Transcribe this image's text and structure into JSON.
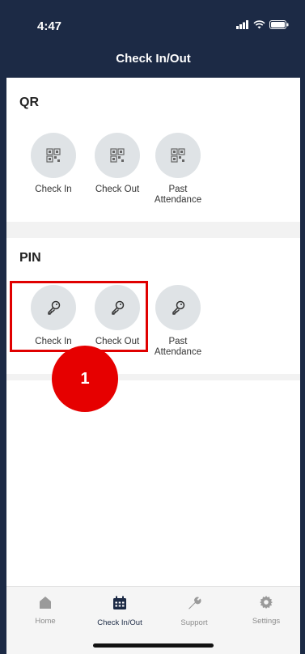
{
  "status_bar": {
    "time": "4:47"
  },
  "header": {
    "title": "Check In/Out"
  },
  "qr_section": {
    "title": "QR",
    "actions": [
      {
        "label": "Check In"
      },
      {
        "label": "Check Out"
      },
      {
        "label": "Past Attendance"
      }
    ]
  },
  "pin_section": {
    "title": "PIN",
    "actions": [
      {
        "label": "Check In"
      },
      {
        "label": "Check Out"
      },
      {
        "label": "Past Attendance"
      }
    ]
  },
  "callout": {
    "number": "1"
  },
  "tabs": [
    {
      "label": "Home",
      "icon": "home-icon"
    },
    {
      "label": "Check In/Out",
      "icon": "calendar-icon"
    },
    {
      "label": "Support",
      "icon": "wrench-icon"
    },
    {
      "label": "Settings",
      "icon": "gear-icon"
    }
  ],
  "colors": {
    "header_bg": "#1c2a45",
    "callout_red": "#e60000",
    "icon_bg": "#dfe3e6"
  }
}
